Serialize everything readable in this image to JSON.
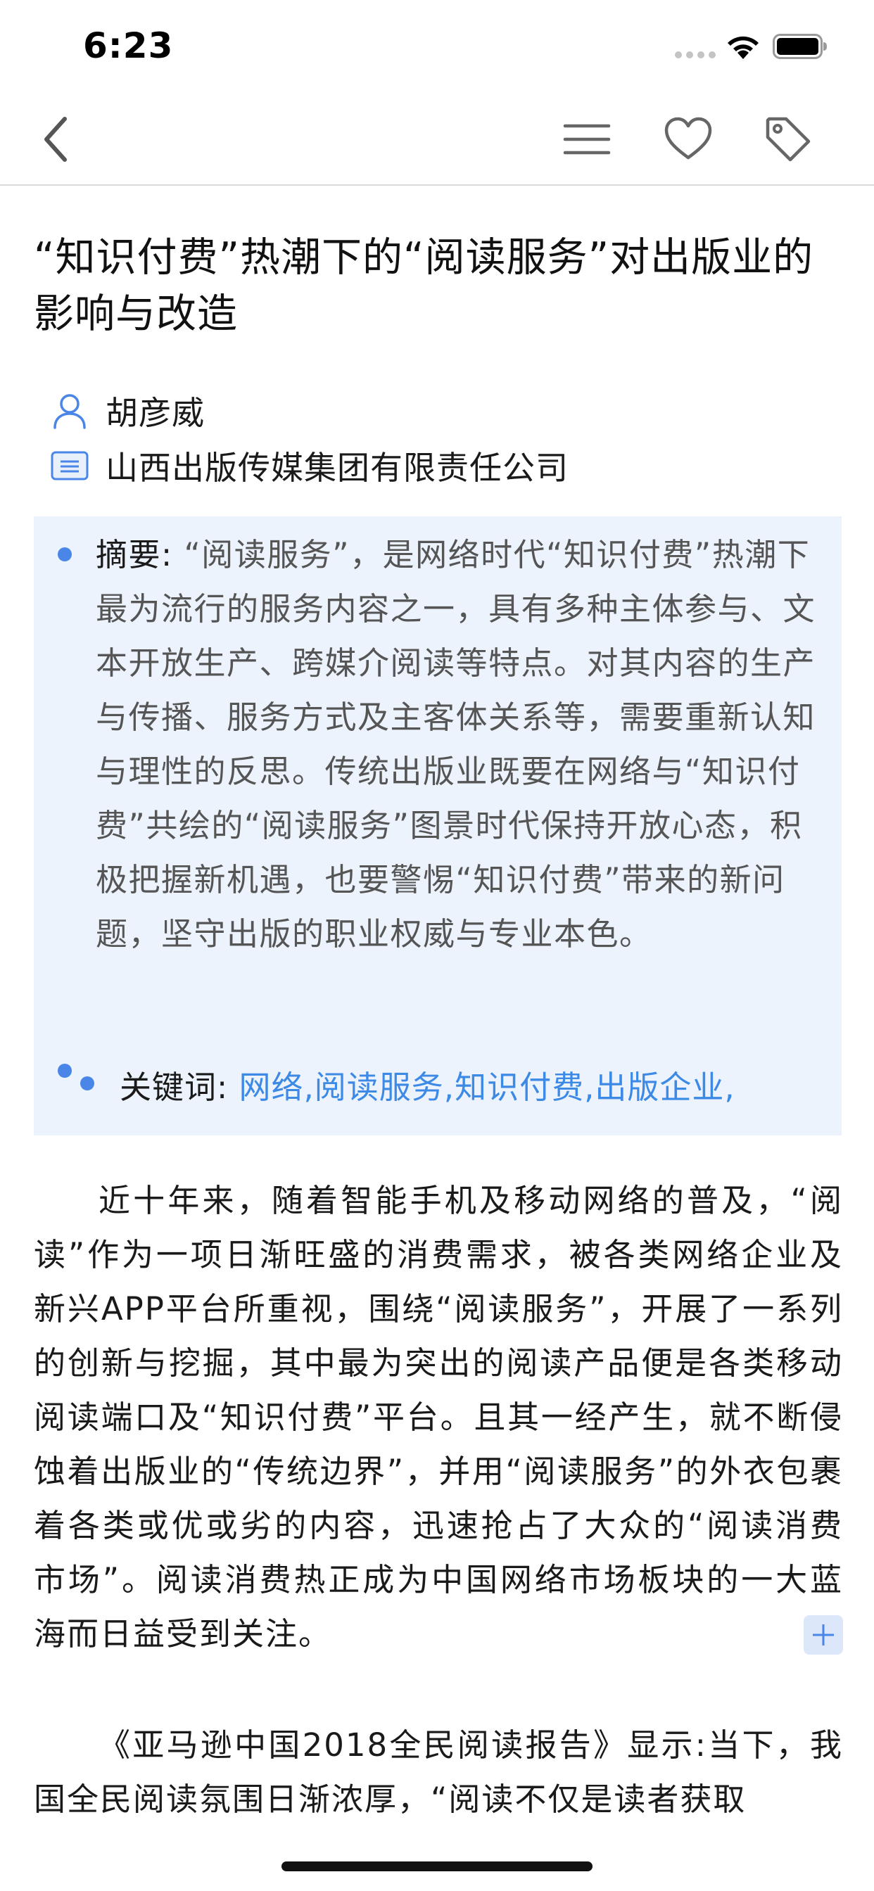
{
  "status_bar": {
    "time": "6:23"
  },
  "nav": {
    "back_icon": "chevron-left-icon",
    "menu_icon": "menu-icon",
    "favorite_icon": "heart-icon",
    "tag_icon": "tag-icon"
  },
  "article": {
    "title": "“知识付费”热潮下的“阅读服务”对出版业的影响与改造",
    "author": "胡彦威",
    "organization": "山西出版传媒集团有限责任公司",
    "abstract_label": "摘要:",
    "abstract_text": " “阅读服务”，是网络时代“知识付费”热潮下最为流行的服务内容之一，具有多种主体参与、文本开放生产、跨媒介阅读等特点。对其内容的生产与传播、服务方式及主客体关系等，需要重新认知与理性的反思。传统出版业既要在网络与“知识付费”共绘的“阅读服务”图景时代保持开放心态，积极把握新机遇，也要警惕“知识付费”带来的新问题，坚守出版的职业权威与专业本色。",
    "keywords_label": "关键词:",
    "keywords": "网络,阅读服务,知识付费,出版企业,",
    "paragraph1": "近十年来，随着智能手机及移动网络的普及，“阅读”作为一项日渐旺盛的消费需求，被各类网络企业及新兴APP平台所重视，围绕“阅读服务”，开展了一系列的创新与挖掘，其中最为突出的阅读产品便是各类移动阅读端口及“知识付费”平台。且其一经产生，就不断侵蚀着出版业的“传统边界”，并用“阅读服务”的外衣包裹着各类或优或劣的内容，迅速抢占了大众的“阅读消费市场”。阅读消费热正成为中国网络市场板块的一大蓝海而日益受到关注。",
    "paragraph2": "《亚马逊中国2018全民阅读报告》显示:当下，我国全民阅读氛围日渐浓厚，“阅读不仅是读者获取"
  },
  "colors": {
    "accent": "#3c8ae6",
    "abstract_bg": "#ecf3fd",
    "icon_blue": "#4a86e8"
  }
}
